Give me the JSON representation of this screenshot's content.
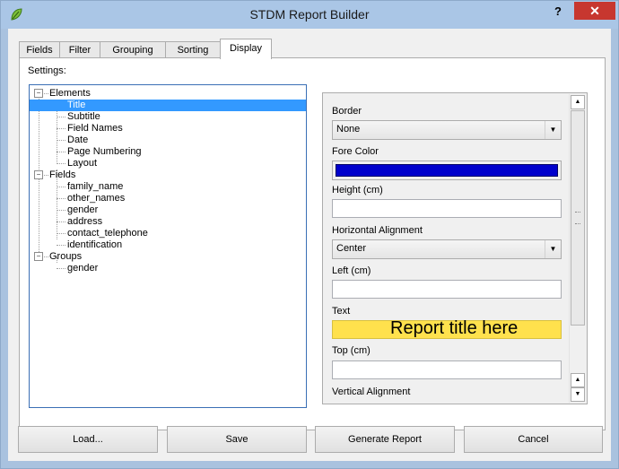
{
  "window": {
    "title": "STDM Report Builder",
    "help_label": "?",
    "close_label": "✕",
    "app_icon": "qgis-leaf-icon"
  },
  "tabs": [
    {
      "label": "Fields",
      "active": false
    },
    {
      "label": "Filter",
      "active": false
    },
    {
      "label": "Grouping",
      "active": false
    },
    {
      "label": "Sorting",
      "active": false
    },
    {
      "label": "Display",
      "active": true
    }
  ],
  "settings": {
    "label": "Settings:",
    "tree": {
      "elements": {
        "label": "Elements",
        "expander": "−",
        "children": [
          "Title",
          "Subtitle",
          "Field Names",
          "Date",
          "Page Numbering",
          "Layout"
        ],
        "selected": "Title"
      },
      "fields": {
        "label": "Fields",
        "expander": "−",
        "children": [
          "family_name",
          "other_names",
          "gender",
          "address",
          "contact_telephone",
          "identification"
        ]
      },
      "groups": {
        "label": "Groups",
        "expander": "−",
        "children": [
          "gender"
        ]
      }
    }
  },
  "properties": {
    "border": {
      "label": "Border",
      "value": "None"
    },
    "fore_color": {
      "label": "Fore Color",
      "value": "#0000cc"
    },
    "height": {
      "label": "Height (cm)",
      "value": ""
    },
    "horizontal_alignment": {
      "label": "Horizontal Alignment",
      "value": "Center"
    },
    "left": {
      "label": "Left (cm)",
      "value": ""
    },
    "text": {
      "label": "Text",
      "value": "Report title here"
    },
    "top": {
      "label": "Top (cm)",
      "value": ""
    },
    "vertical_alignment": {
      "label": "Vertical Alignment"
    }
  },
  "buttons": {
    "load": "Load...",
    "save": "Save",
    "generate": "Generate Report",
    "cancel": "Cancel"
  },
  "colors": {
    "selection": "#3399ff",
    "text_field_bg": "#ffe14d",
    "close_button": "#c7372f"
  }
}
